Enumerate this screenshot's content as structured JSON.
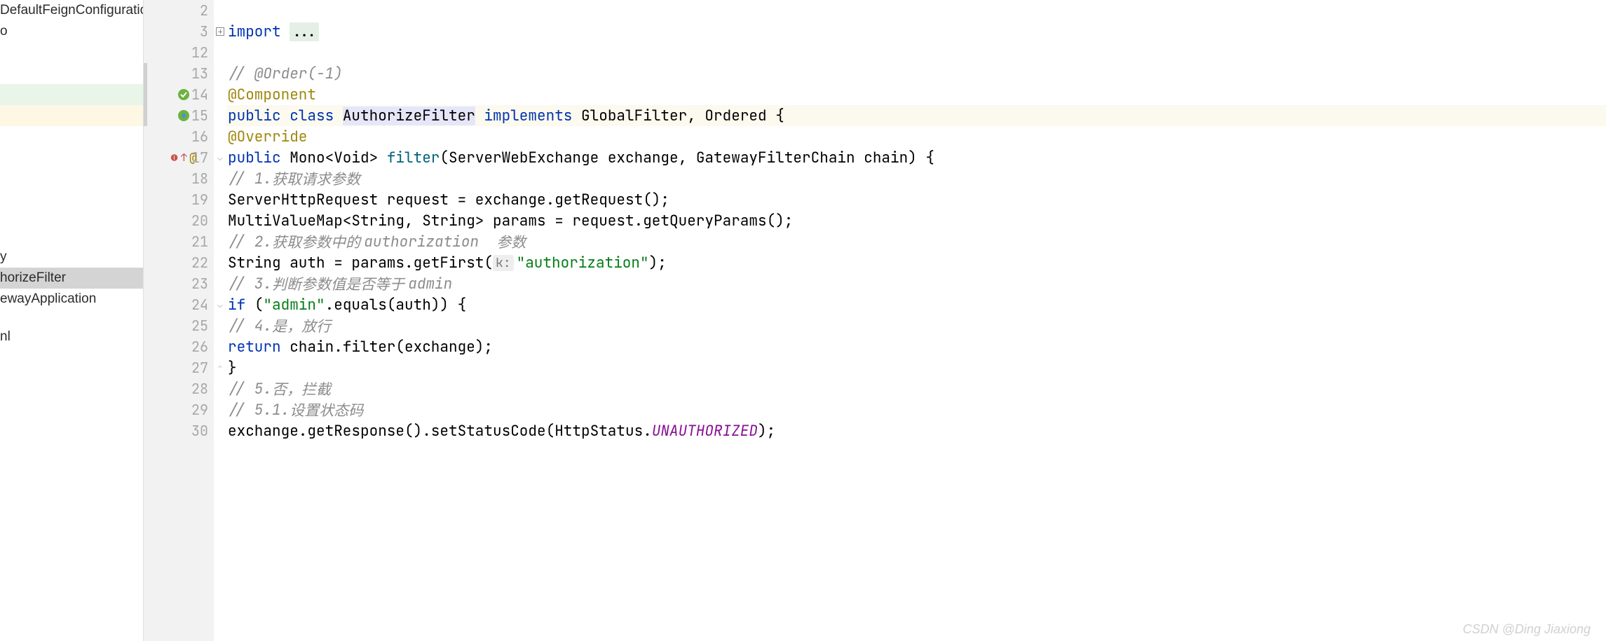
{
  "sidebar": {
    "items": [
      {
        "label": "DefaultFeignConfiguratio"
      },
      {
        "label": "o"
      },
      {
        "label": ""
      },
      {
        "label": ""
      },
      {
        "label": ""
      },
      {
        "label": ""
      },
      {
        "label": ""
      },
      {
        "label": ""
      },
      {
        "label": ""
      },
      {
        "label": ""
      },
      {
        "label": ""
      },
      {
        "label": ""
      },
      {
        "label": "y"
      },
      {
        "label": "horizeFilter"
      },
      {
        "label": "ewayApplication"
      },
      {
        "label": ""
      },
      {
        "label": "nl"
      }
    ],
    "selected_index": 13
  },
  "gutter": {
    "lines": [
      {
        "n": 2
      },
      {
        "n": 3,
        "fold": "plus"
      },
      {
        "n": 12
      },
      {
        "n": 13
      },
      {
        "n": 14,
        "icon": "spring-bean"
      },
      {
        "n": 15,
        "icon": "spring-component"
      },
      {
        "n": 16
      },
      {
        "n": 17,
        "icon": "override",
        "atsign": true,
        "fold": "tick"
      },
      {
        "n": 18
      },
      {
        "n": 19
      },
      {
        "n": 20
      },
      {
        "n": 21
      },
      {
        "n": 22
      },
      {
        "n": 23
      },
      {
        "n": 24,
        "fold": "tick"
      },
      {
        "n": 25
      },
      {
        "n": 26
      },
      {
        "n": 27,
        "fold": "tick"
      },
      {
        "n": 28
      },
      {
        "n": 29
      },
      {
        "n": 30
      }
    ]
  },
  "code": {
    "l3": {
      "kw": "import ",
      "dots": "..."
    },
    "l13": {
      "c": "// @Order(-1)"
    },
    "l14": {
      "anno": "@Component"
    },
    "l15": {
      "p1": "public ",
      "p2": "class ",
      "name": "AuthorizeFilter",
      "p3": " implements ",
      "rest": "GlobalFilter, Ordered {"
    },
    "l16": {
      "anno": "@Override"
    },
    "l17": {
      "p1": "public ",
      "ret": "Mono<Void> ",
      "mtd": "filter",
      "sig": "(ServerWebExchange exchange, GatewayFilterChain chain) {"
    },
    "l18": {
      "c1": "// 1.",
      "c2": "获取请求参数"
    },
    "l19": {
      "t": "ServerHttpRequest request = exchange.getRequest();"
    },
    "l20": {
      "t": "MultiValueMap<String, String> params = request.getQueryParams();"
    },
    "l21": {
      "c1": "// 2.",
      "c2": "获取参数中的 ",
      "c3": "authorization  ",
      "c4": "参数"
    },
    "l22": {
      "a": "String auth = params.getFirst(",
      "hint": "k:",
      "str": "\"authorization\"",
      "b": ");"
    },
    "l23": {
      "c1": "// 3.",
      "c2": "判断参数值是否等于 ",
      "c3": "admin"
    },
    "l24": {
      "kw": "if ",
      "a": "(",
      "str": "\"admin\"",
      "b": ".equals(auth)) {"
    },
    "l25": {
      "c1": "// 4.",
      "c2": "是，放行"
    },
    "l26": {
      "kw": "return ",
      "rest": "chain.filter(exchange);"
    },
    "l27": {
      "t": "}"
    },
    "l28": {
      "c1": "// 5.",
      "c2": "否，拦截"
    },
    "l29": {
      "c1": "// 5.1.",
      "c2": "设置状态码"
    },
    "l30": {
      "a": "exchange.getResponse().setStatusCode(HttpStatus.",
      "const": "UNAUTHORIZED",
      "b": ");"
    }
  },
  "watermark": "CSDN @Ding Jiaxiong"
}
